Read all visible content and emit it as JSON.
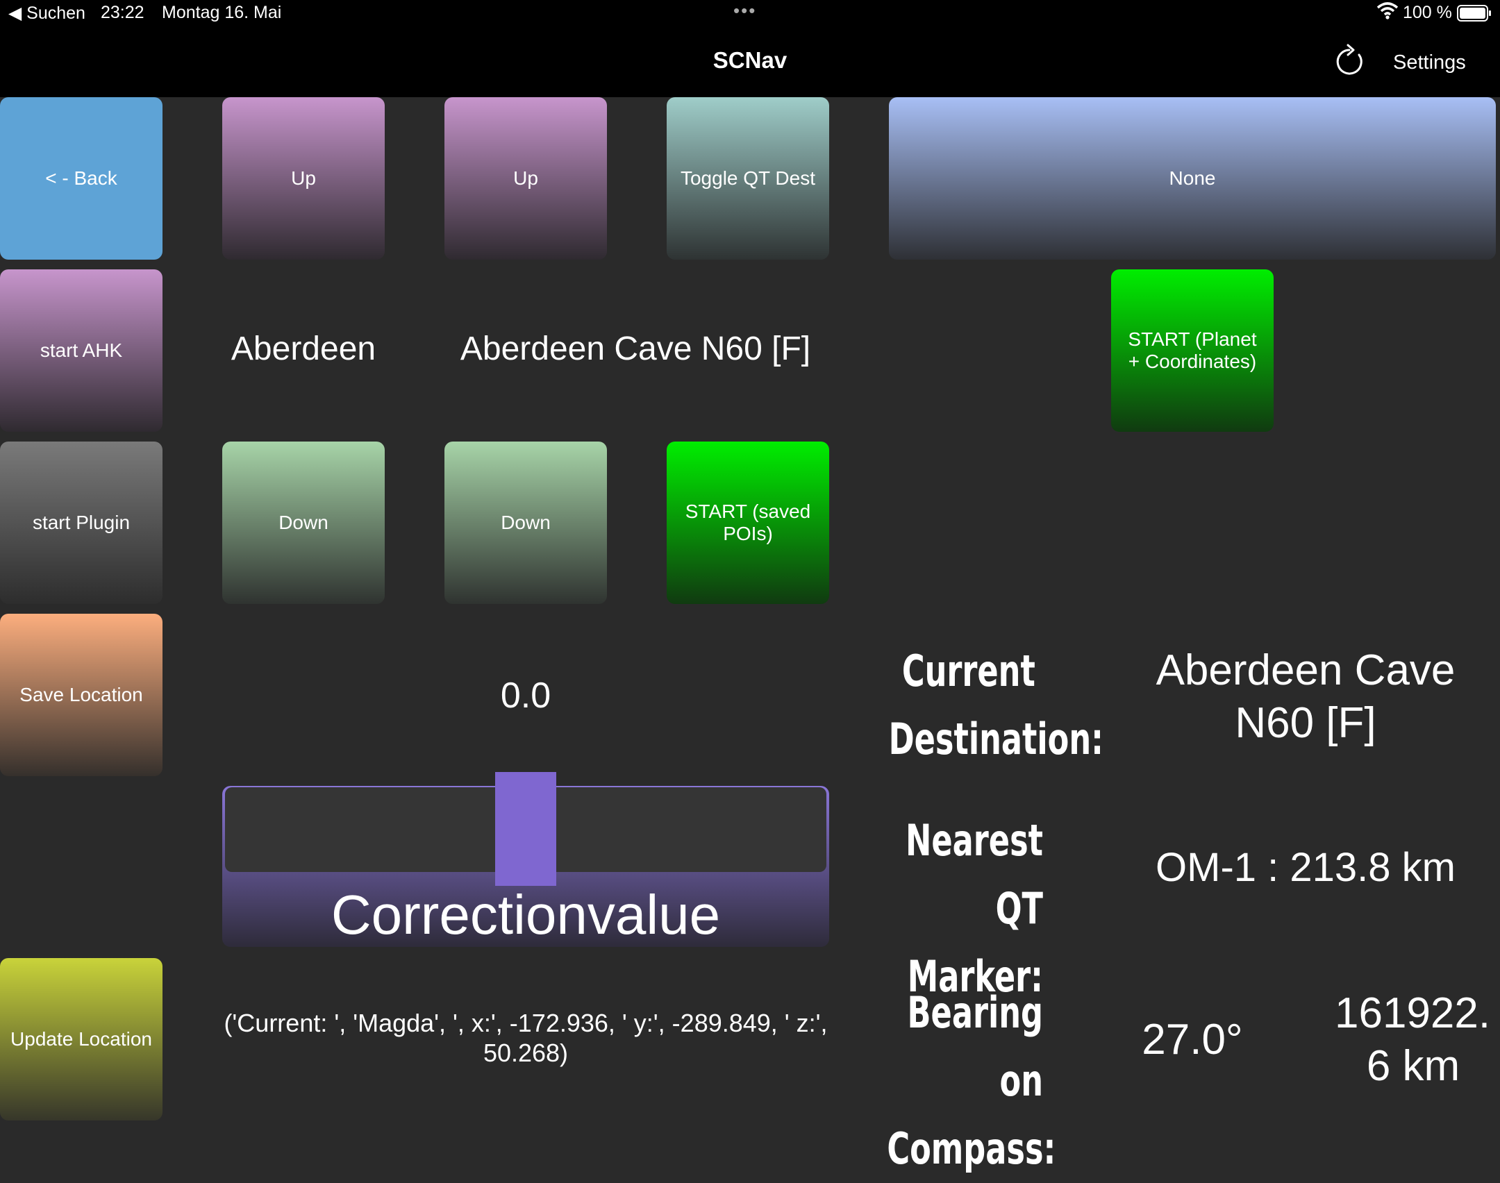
{
  "status_bar": {
    "back_app": "◀ Suchen",
    "time": "23:22",
    "date": "Montag 16. Mai",
    "dots": "•••",
    "battery": "100 %"
  },
  "nav": {
    "title": "SCNav",
    "settings": "Settings",
    "refresh_icon": "refresh-icon"
  },
  "left_buttons": {
    "back": "< - Back",
    "start_ahk": "start AHK",
    "start_plugin": "start Plugin",
    "save_location": "Save Location",
    "update_location": "Update Location"
  },
  "controls": {
    "up1": "Up",
    "up2": "Up",
    "toggle_qt": "Toggle QT Dest",
    "none": "None",
    "planet": "Aberdeen",
    "poi": "Aberdeen Cave N60 [F]",
    "start_planet": "START (Planet + Coordinates)",
    "down1": "Down",
    "down2": "Down",
    "start_saved": "START (saved POIs)"
  },
  "correction": {
    "value_text": "0.0",
    "label": "Correctionvalue",
    "value": 0.5
  },
  "current_location_text": "('Current: ', 'Magda', ', x:', -172.936, ' y:', -289.849, ' z:', 50.268)",
  "info": {
    "current_destination_label_1": "Current",
    "current_destination_label_2": "Destination:",
    "current_destination_value_1": "Aberdeen Cave",
    "current_destination_value_2": "N60 [F]",
    "nearest_label_1": "Nearest",
    "nearest_label_2": "QT Marker:",
    "nearest_value": "OM-1 : 213.8 km",
    "bearing_label_1": "Bearing on",
    "bearing_label_2": "Compass:",
    "bearing_value": "27.0°",
    "distance_value_1": "161922.",
    "distance_value_2": "6 km"
  },
  "colors": {
    "accent": "#7f67d0",
    "green": "#00ee00",
    "blue": "#5ea3d6"
  }
}
